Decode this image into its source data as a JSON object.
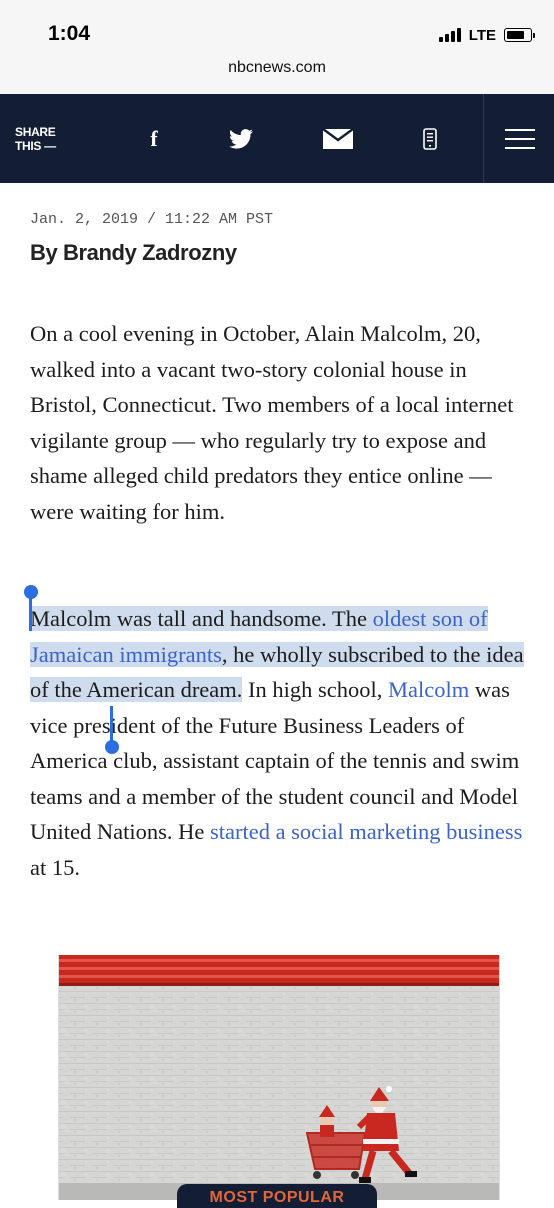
{
  "status_bar": {
    "time": "1:04",
    "network": "LTE",
    "url": "nbcnews.com"
  },
  "share_bar": {
    "label_line1": "SHARE",
    "label_line2": "THIS —",
    "icons": [
      "facebook-icon",
      "twitter-icon",
      "email-icon",
      "sms-icon",
      "menu-icon"
    ],
    "facebook_glyph": "f",
    "background": "#131d33"
  },
  "article": {
    "dateline": "Jan. 2, 2019 / 11:22 AM PST",
    "byline": "By Brandy Zadrozny",
    "paragraph1": "On a cool evening in October, Alain Malcolm, 20, walked into a vacant two-story colonial house in Bristol, Connecticut. Two members of a local internet vigilante group — who regularly try to expose and shame alleged child predators they entice online — were waiting for him.",
    "paragraph2": {
      "s1": "Malcolm was tall and handsome. The ",
      "link1": "oldest son of Jamaican immigrants",
      "s2": ", he wholly subscribed to the idea of the American dream.",
      "s3": " In high school, ",
      "link2": "Malcolm",
      "s4": " was vice president of the Future Business Leaders of America club, assistant captain of the tennis and swim teams and a member of the student council and Model United Nations. He ",
      "link3": "started a social marketing business",
      "s5": " at 15."
    },
    "link_color": "#3b63c9",
    "selection_color": "#cfdcee"
  },
  "photo": {
    "description_icon": "santa-pushing-cart-image"
  },
  "most_popular": {
    "label": "MOST POPULAR",
    "accent": "#e0673a"
  }
}
